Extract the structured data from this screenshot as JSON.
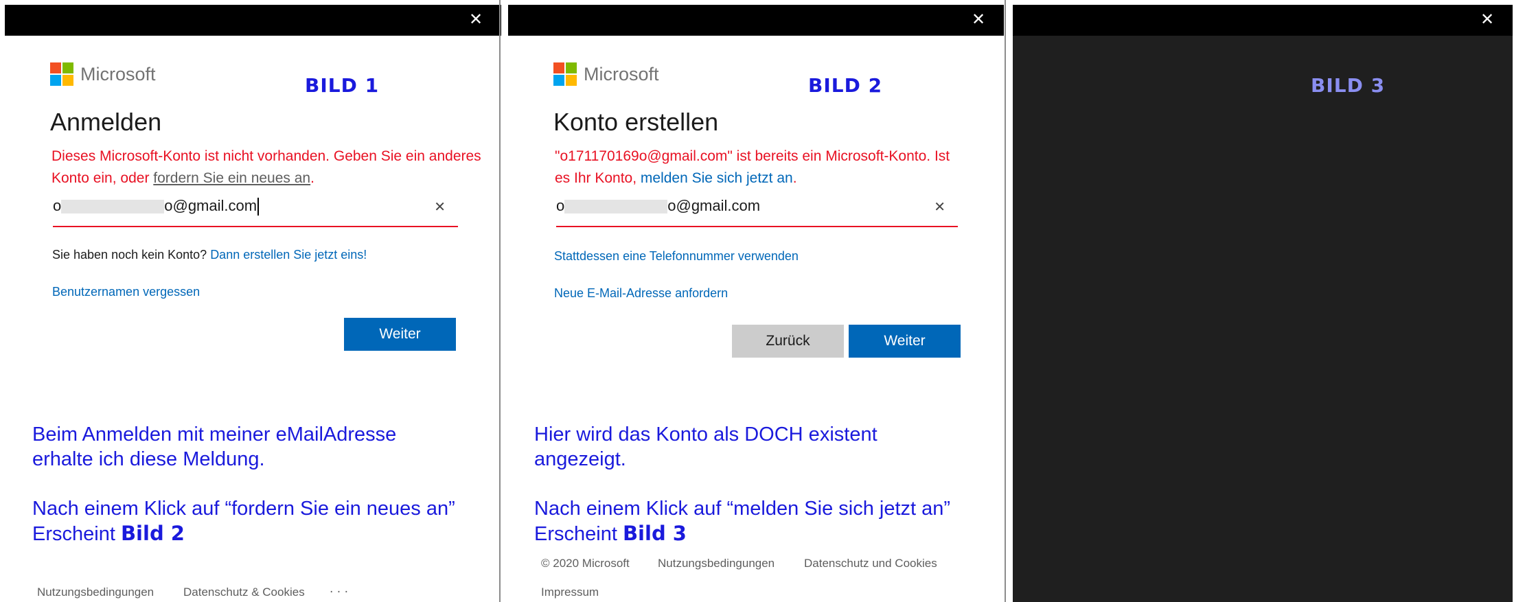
{
  "brand": {
    "name": "Microsoft",
    "colors": [
      "#f25022",
      "#7fba00",
      "#00a4ef",
      "#ffb900"
    ]
  },
  "panel1": {
    "tag": "BILD 1",
    "title": "Anmelden",
    "error_text": "Dieses Microsoft-Konto ist nicht vorhanden. Geben Sie ein anderes Konto ein, oder ",
    "error_link": "fordern Sie ein neues an",
    "error_end": ".",
    "email_prefix": "o",
    "email_suffix": "o@gmail.com",
    "no_account_text": "Sie haben noch kein Konto? ",
    "create_link": "Dann erstellen Sie jetzt eins!",
    "forgot_link": "Benutzernamen vergessen",
    "next_button": "Weiter",
    "note_line1": "Beim Anmelden mit meiner eMailAdresse",
    "note_line2": "erhalte ich diese Meldung.",
    "note_line3": "Nach einem Klick auf “fordern Sie ein neues an”",
    "note_line4_pre": "Erscheint ",
    "note_line4_bold": "Bild 2",
    "footer": {
      "terms": "Nutzungsbedingungen",
      "privacy": "Datenschutz & Cookies",
      "more": "· · ·"
    }
  },
  "panel2": {
    "tag": "BILD 2",
    "title": "Konto erstellen",
    "error_text": "\"o171170169o@gmail.com\" ist bereits ein Microsoft-Konto. Ist es Ihr Konto, ",
    "error_link": "melden Sie sich jetzt an",
    "error_end": ".",
    "email_prefix": "o",
    "email_suffix": "o@gmail.com",
    "phone_link": "Stattdessen eine Telefonnummer verwenden",
    "new_email_link": "Neue E-Mail-Adresse anfordern",
    "back_button": "Zurück",
    "next_button": "Weiter",
    "note_line1": "Hier wird das Konto als DOCH existent",
    "note_line2": "angezeigt.",
    "note_line3": "Nach einem Klick auf “melden Sie sich jetzt an”",
    "note_line4_pre": "Erscheint ",
    "note_line4_bold": "Bild 3",
    "footer": {
      "copyright": "© 2020 Microsoft",
      "terms": "Nutzungsbedingungen",
      "privacy": "Datenschutz und Cookies",
      "imprint": "Impressum"
    }
  },
  "panel3": {
    "tag": "BILD 3"
  },
  "close_glyph": "✕",
  "clear_glyph": "✕"
}
